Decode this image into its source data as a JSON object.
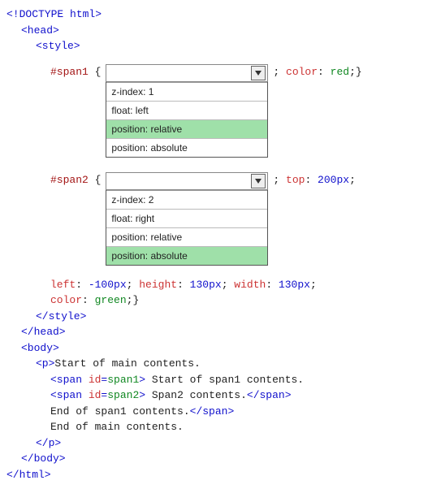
{
  "code": {
    "doctype": "<!DOCTYPE html>",
    "head_open": "<head>",
    "style_open": "<style>",
    "style_close": "</style>",
    "head_close": "</head>",
    "body_open": "<body>",
    "body_close": "</body>",
    "html_close": "</html>",
    "p_open": "<p>",
    "p_close": "</p>",
    "span_close": "</span>"
  },
  "rule1": {
    "selector": "#span1",
    "open_brace": " {",
    "trail_text": "; ",
    "prop": "color",
    "colon": ": ",
    "value": "red",
    "close": ";}",
    "dropdown": {
      "opt1": "z-index: 1",
      "opt2": "float: left",
      "opt3": "position: relative",
      "opt4": "position: absolute"
    }
  },
  "rule2": {
    "selector": "#span2",
    "open_brace": " {",
    "trail_text": "; ",
    "prop": "top",
    "colon": ": ",
    "value": "200px",
    "end_semi": ";",
    "dropdown": {
      "opt1": "z-index: 2",
      "opt2": "float: right",
      "opt3": "position: relative",
      "opt4": "position: absolute"
    },
    "cont": {
      "left_lbl": "left",
      "left_val": "-100px",
      "h_lbl": "height",
      "h_val": "130px",
      "w_lbl": "width",
      "w_val": "130px",
      "color_lbl": "color",
      "color_val": "green",
      "close": ";}"
    }
  },
  "bodytext": {
    "start_main": "Start of main contents.",
    "span1_open_a": "<span ",
    "span1_attr": "id",
    "span1_eq": "=",
    "span1_val": "span1",
    "span1_open_b": ">",
    "span1_text": " Start of span1 contents.",
    "span2_open_a": "<span ",
    "span2_attr": "id",
    "span2_eq": "=",
    "span2_val": "span2",
    "span2_open_b": ">",
    "span2_text": " Span2 contents.",
    "end_span1": "End of span1 contents.",
    "end_main": "End of main contents."
  }
}
